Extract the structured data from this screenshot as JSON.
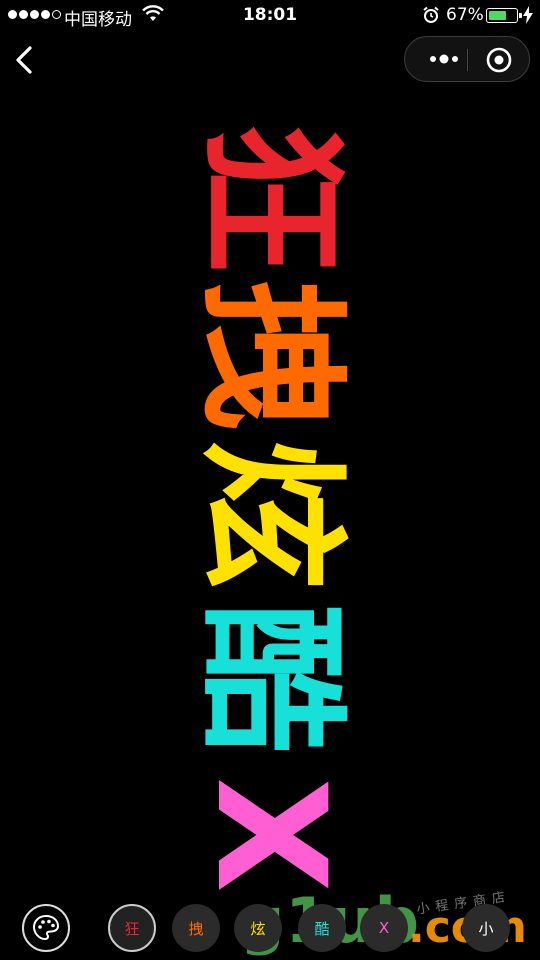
{
  "status": {
    "carrier": "中国移动",
    "time": "18:01",
    "battery_pct": "67%",
    "battery_level": 0.67
  },
  "nav": {
    "back_icon": "chevron-left-icon",
    "more_icon": "more-dots-icon",
    "close_icon": "target-circle-icon"
  },
  "display_chars": [
    {
      "text": "狂",
      "color": "#e8242c"
    },
    {
      "text": "拽",
      "color": "#ff6a00"
    },
    {
      "text": "炫",
      "color": "#ffe100"
    },
    {
      "text": "酷",
      "color": "#16e0d8"
    },
    {
      "text": "X",
      "color": "#ff5fd2"
    }
  ],
  "toolbar": {
    "palette_icon": "palette-icon",
    "chips": [
      {
        "label": "狂",
        "color": "#e8242c"
      },
      {
        "label": "拽",
        "color": "#ff6a00"
      },
      {
        "label": "炫",
        "color": "#ffe100"
      },
      {
        "label": "酷",
        "color": "#16e0d8"
      },
      {
        "label": "X",
        "color": "#ff5fd2"
      },
      {
        "label": "小",
        "color": "#ffffff"
      }
    ]
  },
  "watermark": {
    "main": "g1ub",
    "suffix": ".com",
    "small": "小程序商店"
  }
}
